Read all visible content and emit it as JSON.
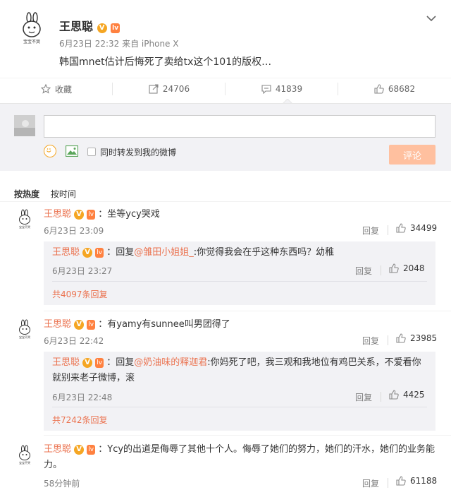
{
  "post": {
    "author": "王思聪",
    "meta": "6月23日 22:32 来自 iPhone X",
    "text": "韩国mnet估计后悔死了卖给tx这个101的版权…",
    "avatar_caption": "宝宝不哭",
    "v_badge": "V",
    "lv_badge": "lv"
  },
  "actions": {
    "favorite": "收藏",
    "repost": "24706",
    "comment": "41839",
    "like": "68682"
  },
  "compose": {
    "input_value": "",
    "checkbox_label": "同时转发到我的微博",
    "submit_label": "评论"
  },
  "sort": {
    "by_hot": "按热度",
    "by_time": "按时间"
  },
  "comments": [
    {
      "name": "王思聪",
      "text": "：坐等ycy哭戏",
      "time": "6月23日 23:09",
      "reply": "回复",
      "likes": "34499",
      "sub": {
        "name": "王思聪",
        "prefix": "：回复",
        "mention": "@雏田小姐姐_",
        "text": ":你觉得我会在乎这种东西吗？幼稚",
        "time": "6月23日 23:27",
        "reply": "回复",
        "likes": "2048",
        "more": "共4097条回复"
      }
    },
    {
      "name": "王思聪",
      "text": "：有yamy有sunnee叫男团得了",
      "time": "6月23日 22:42",
      "reply": "回复",
      "likes": "23985",
      "sub": {
        "name": "王思聪",
        "prefix": "：回复",
        "mention": "@奶油味的释迦君",
        "text": ":你妈死了吧，我三观和我地位有鸡巴关系，不爱看你就别来老子微博，滚",
        "time": "6月23日 22:48",
        "reply": "回复",
        "likes": "4425",
        "more": "共7242条回复"
      }
    },
    {
      "name": "王思聪",
      "text": "：Ycy的出道是侮辱了其他十个人。侮辱了她们的努力，她们的汗水，她们的业务能力。",
      "time": "58分钟前",
      "reply": "回复",
      "likes": "61188"
    }
  ],
  "colors": {
    "accent": "#eb7350",
    "submit_bg": "#ffc09f",
    "compose_bg": "#f2f2f5",
    "vip_badge": "#f5a623"
  }
}
